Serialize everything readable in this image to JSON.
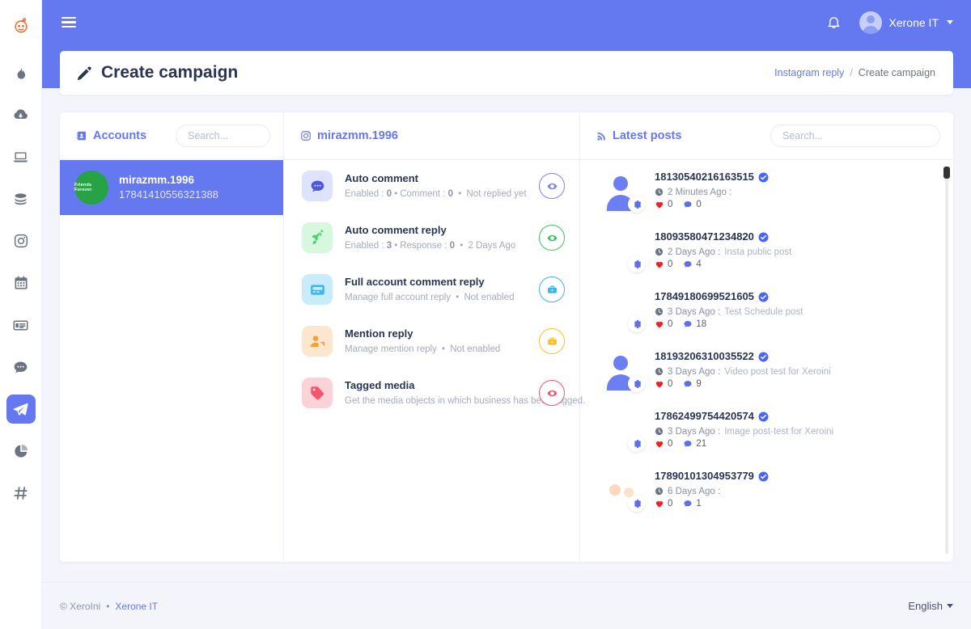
{
  "colors": {
    "brand": "#6478f0",
    "accent_orange": "#f3662a",
    "green": "#27a345",
    "page_bg": "#f4f5fb",
    "heading": "#2b3553",
    "muted": "#a5abbd"
  },
  "sidebar": {
    "items": [
      {
        "name": "brand-logo",
        "icon": "owl-brand-icon",
        "active": false
      },
      {
        "name": "fire",
        "icon": "flame-icon",
        "active": false
      },
      {
        "name": "downloads",
        "icon": "cloud-download-icon",
        "active": false
      },
      {
        "name": "developer",
        "icon": "laptop-code-icon",
        "active": false
      },
      {
        "name": "database",
        "icon": "coins-stack-icon",
        "active": false
      },
      {
        "name": "instagram",
        "icon": "instagram-icon",
        "active": false
      },
      {
        "name": "calendar",
        "icon": "calendar-icon",
        "active": false
      },
      {
        "name": "feed",
        "icon": "list-card-icon",
        "active": false
      },
      {
        "name": "messages",
        "icon": "comment-dots-icon",
        "active": false
      },
      {
        "name": "campaign",
        "icon": "paper-plane-icon",
        "active": true
      },
      {
        "name": "analytics",
        "icon": "pie-chart-icon",
        "active": false
      },
      {
        "name": "hashtags",
        "icon": "hashtag-icon",
        "active": false
      }
    ]
  },
  "topbar": {
    "menu_icon": "hamburger-icon",
    "bell_icon": "bell-icon",
    "user_name": "Xerone IT",
    "avatar_icon": "user-avatar-icon"
  },
  "page": {
    "title": "Create campaign",
    "title_icon": "pencil-icon",
    "breadcrumb": {
      "parent": "Instagram reply",
      "separator": "/",
      "current": "Create campaign"
    }
  },
  "accounts_panel": {
    "title": "Accounts",
    "title_icon": "address-book-icon",
    "search_placeholder": "Search...",
    "search_value": "",
    "rows": [
      {
        "avatar_text": "Friends Forever",
        "avatar_color": "#27a345",
        "name": "mirazmm.1996",
        "id": "17841410556321388",
        "selected": true
      }
    ]
  },
  "actions_panel": {
    "title": "mirazmm.1996",
    "title_icon": "instagram-icon",
    "items": [
      {
        "icon": "comment-dots-icon",
        "icon_bg": "#dfe2fb",
        "icon_color": "#4d5ad8",
        "title": "Auto comment",
        "meta": [
          {
            "label": "Enabled : ",
            "value": "0"
          },
          {
            "label": "Comment : ",
            "value": "0"
          },
          {
            "label": "Not replied yet",
            "value": ""
          }
        ],
        "button_icon": "eye-icon",
        "button_color": "#7b85e8"
      },
      {
        "icon": "rocket-icon",
        "icon_bg": "#d7f7de",
        "icon_color": "#4fd173",
        "title": "Auto comment reply",
        "meta": [
          {
            "label": "Enabled : ",
            "value": "3"
          },
          {
            "label": "Response : ",
            "value": "0"
          },
          {
            "label": "2 Days Ago",
            "value": ""
          }
        ],
        "button_icon": "eye-icon",
        "button_color": "#3fc15f"
      },
      {
        "icon": "id-card-icon",
        "icon_bg": "#c9ecfb",
        "icon_color": "#46b6e8",
        "title": "Full account comment reply",
        "meta": [
          {
            "label": "Manage full account reply",
            "value": ""
          },
          {
            "label": "Not enabled",
            "value": ""
          }
        ],
        "button_icon": "briefcase-icon",
        "button_color": "#3cb4e6"
      },
      {
        "icon": "user-tag-icon",
        "icon_bg": "#fce6cd",
        "icon_color": "#f0a33c",
        "title": "Mention reply",
        "meta": [
          {
            "label": "Manage mention reply",
            "value": ""
          },
          {
            "label": "Not enabled",
            "value": ""
          }
        ],
        "button_icon": "briefcase-icon",
        "button_color": "#fcc02e"
      },
      {
        "icon": "tags-icon",
        "icon_bg": "#fbd2d7",
        "icon_color": "#f2566e",
        "title": "Tagged media",
        "meta": [
          {
            "label": "Get the media objects in which business has been tagged.",
            "value": ""
          }
        ],
        "button_icon": "eye-icon",
        "button_color": "#f2566e"
      }
    ]
  },
  "posts_panel": {
    "title": "Latest posts",
    "title_icon": "rss-icon",
    "search_placeholder": "Search...",
    "search_value": "",
    "scrollbar": {
      "visible": true,
      "thumb_position": "top"
    },
    "posts": [
      {
        "id": "18130540216163515",
        "verified": true,
        "time": "2 Minutes Ago :",
        "caption": "",
        "likes": "0",
        "comments": "0",
        "thumb": "placeholder"
      },
      {
        "id": "18093580471234820",
        "verified": true,
        "time": "2 Days Ago :",
        "caption": "Insta public post",
        "likes": "0",
        "comments": "4",
        "thumb": "autumn"
      },
      {
        "id": "17849180699521605",
        "verified": true,
        "time": "3 Days Ago :",
        "caption": "Test Schedule post",
        "likes": "0",
        "comments": "18",
        "thumb": "forest"
      },
      {
        "id": "18193206310035522",
        "verified": true,
        "time": "3 Days Ago :",
        "caption": "Video post test for Xeroini",
        "likes": "0",
        "comments": "9",
        "thumb": "placeholder"
      },
      {
        "id": "17862499754420574",
        "verified": true,
        "time": "3 Days Ago :",
        "caption": "Image post-test for Xeroini",
        "likes": "0",
        "comments": "21",
        "thumb": "autumn"
      },
      {
        "id": "17890101304953779",
        "verified": true,
        "time": "6 Days Ago :",
        "caption": "",
        "likes": "0",
        "comments": "1",
        "thumb": "meme"
      }
    ]
  },
  "footer": {
    "copyright": "© XeroIni",
    "separator": "•",
    "company": "Xerone IT",
    "language": "English"
  }
}
